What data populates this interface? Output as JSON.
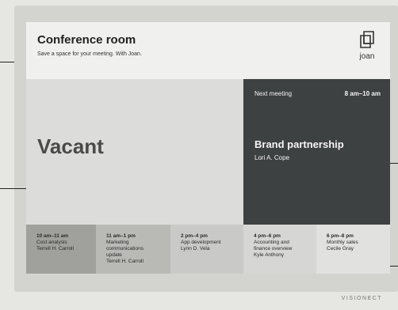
{
  "room": {
    "title": "Conference room",
    "subtitle": "Save a space for your meeting. With Joan."
  },
  "logo": {
    "icon": "joan-logo-icon",
    "text": "joan"
  },
  "status": {
    "text": "Vacant"
  },
  "next_meeting": {
    "label": "Next meeting",
    "time": "8 am–10 am",
    "title": "Brand partnership",
    "organizer": "Lori A. Cope"
  },
  "schedule": [
    {
      "time": "10 am–11 am",
      "lines": [
        "Cost analysis",
        "Terrell H. Carroll"
      ],
      "bg": "#a0a19d"
    },
    {
      "time": "11 am–1 pm",
      "lines": [
        "Marketing",
        "communications",
        "update",
        "Terrell H. Carroll"
      ],
      "bg": "#b9bab6"
    },
    {
      "time": "2 pm–4 pm",
      "lines": [
        "App development",
        "Lynn D. Vela"
      ],
      "bg": "#c9cac7"
    },
    {
      "time": "4 pm–6 pm",
      "lines": [
        "Accounting and",
        "finance overview",
        "Kyle Anthony"
      ],
      "bg": "#d6d6d4"
    },
    {
      "time": "6 pm–8 pm",
      "lines": [
        "Monthly sales",
        "Cecile Gray"
      ],
      "bg": "#e1e1e0"
    }
  ],
  "brand": "VISIONECT"
}
